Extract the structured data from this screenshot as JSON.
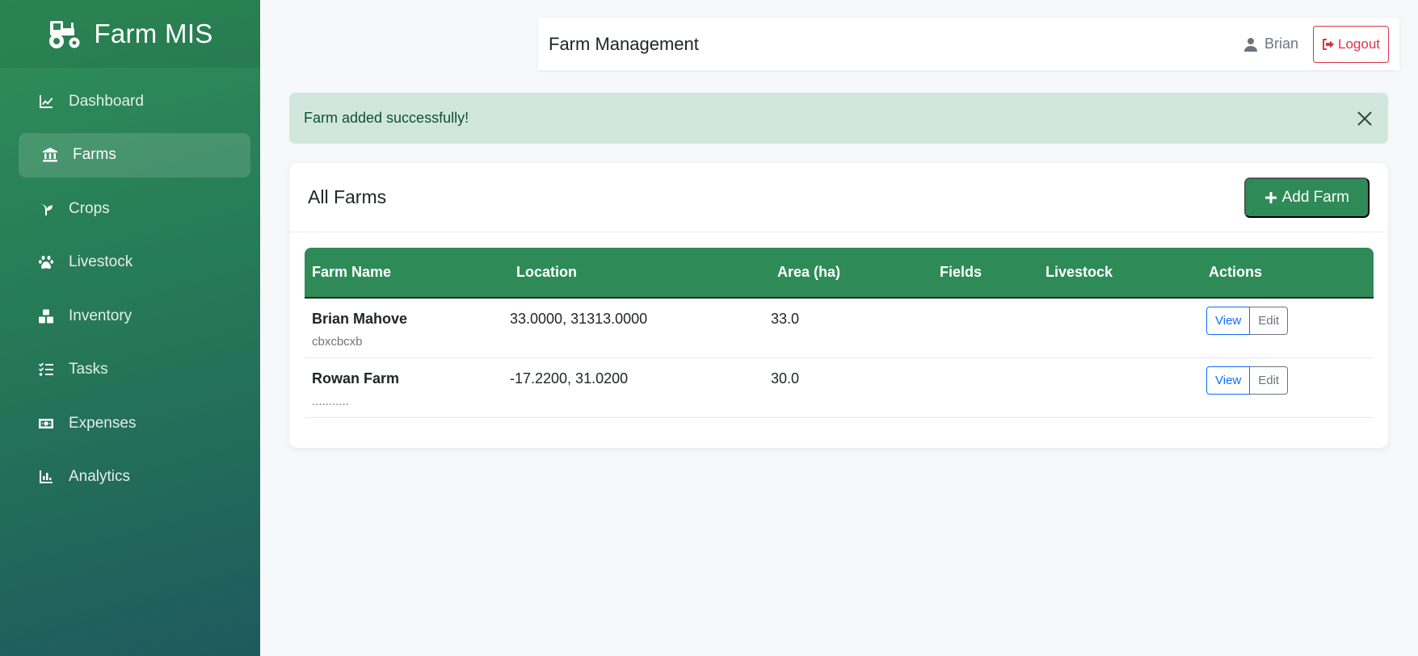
{
  "brand": {
    "title": "Farm MIS",
    "icon": "tractor-icon"
  },
  "sidebar": {
    "items": [
      {
        "label": "Dashboard",
        "icon": "chart-line-icon",
        "active": false
      },
      {
        "label": "Farms",
        "icon": "building-columns-icon",
        "active": true
      },
      {
        "label": "Crops",
        "icon": "seedling-icon",
        "active": false
      },
      {
        "label": "Livestock",
        "icon": "paw-icon",
        "active": false
      },
      {
        "label": "Inventory",
        "icon": "boxes-icon",
        "active": false
      },
      {
        "label": "Tasks",
        "icon": "list-check-icon",
        "active": false
      },
      {
        "label": "Expenses",
        "icon": "money-bill-icon",
        "active": false
      },
      {
        "label": "Analytics",
        "icon": "chart-bar-icon",
        "active": false
      }
    ]
  },
  "header": {
    "title": "Farm Management",
    "user": "Brian",
    "logout_label": "Logout"
  },
  "alert": {
    "message": "Farm added successfully!"
  },
  "farms_card": {
    "title": "All Farms",
    "add_label": "Add Farm",
    "columns": [
      "Farm Name",
      "Location",
      "Area (ha)",
      "Fields",
      "Livestock",
      "Actions"
    ],
    "rows": [
      {
        "name": "Brian Mahove",
        "description": "cbxcbcxb",
        "location": "33.0000, 31313.0000",
        "area": "33.0",
        "fields": "",
        "livestock": "",
        "view_label": "View",
        "edit_label": "Edit"
      },
      {
        "name": "Rowan Farm",
        "description": "...........",
        "location": "-17.2200, 31.0200",
        "area": "30.0",
        "fields": "",
        "livestock": "",
        "view_label": "View",
        "edit_label": "Edit"
      }
    ]
  },
  "colors": {
    "primary": "#2e8b57",
    "alert_bg": "#d1e7dd",
    "danger": "#dc3545",
    "link": "#0d6efd"
  }
}
